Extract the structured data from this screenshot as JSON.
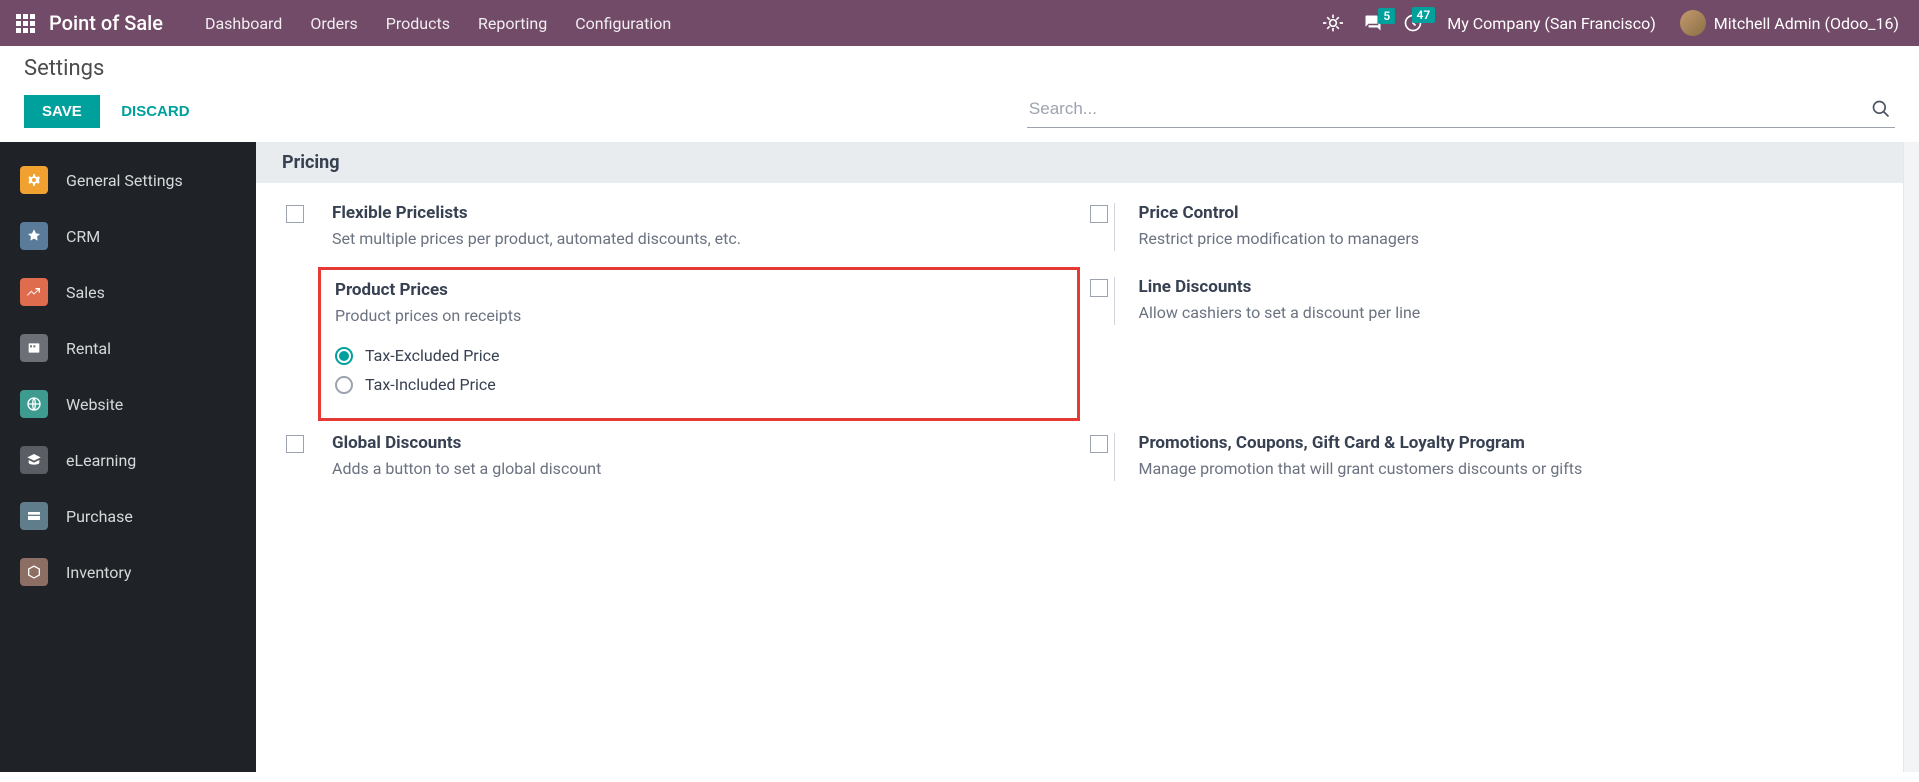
{
  "topbar": {
    "app_title": "Point of Sale",
    "nav": [
      "Dashboard",
      "Orders",
      "Products",
      "Reporting",
      "Configuration"
    ],
    "msg_count": "5",
    "activity_count": "47",
    "company": "My Company (San Francisco)",
    "user": "Mitchell Admin (Odoo_16)"
  },
  "control_panel": {
    "title": "Settings",
    "save": "SAVE",
    "discard": "DISCARD",
    "search_placeholder": "Search..."
  },
  "sidebar": {
    "items": [
      {
        "label": "General Settings"
      },
      {
        "label": "CRM"
      },
      {
        "label": "Sales"
      },
      {
        "label": "Rental"
      },
      {
        "label": "Website"
      },
      {
        "label": "eLearning"
      },
      {
        "label": "Purchase"
      },
      {
        "label": "Inventory"
      }
    ]
  },
  "section": {
    "title": "Pricing"
  },
  "settings": {
    "flexible_pricelists": {
      "title": "Flexible Pricelists",
      "desc": "Set multiple prices per product, automated discounts, etc."
    },
    "price_control": {
      "title": "Price Control",
      "desc": "Restrict price modification to managers"
    },
    "product_prices": {
      "title": "Product Prices",
      "desc": "Product prices on receipts",
      "opt1": "Tax-Excluded Price",
      "opt2": "Tax-Included Price"
    },
    "line_discounts": {
      "title": "Line Discounts",
      "desc": "Allow cashiers to set a discount per line"
    },
    "global_discounts": {
      "title": "Global Discounts",
      "desc": "Adds a button to set a global discount"
    },
    "promotions": {
      "title": "Promotions, Coupons, Gift Card & Loyalty Program",
      "desc": "Manage promotion that will grant customers discounts or gifts"
    }
  }
}
